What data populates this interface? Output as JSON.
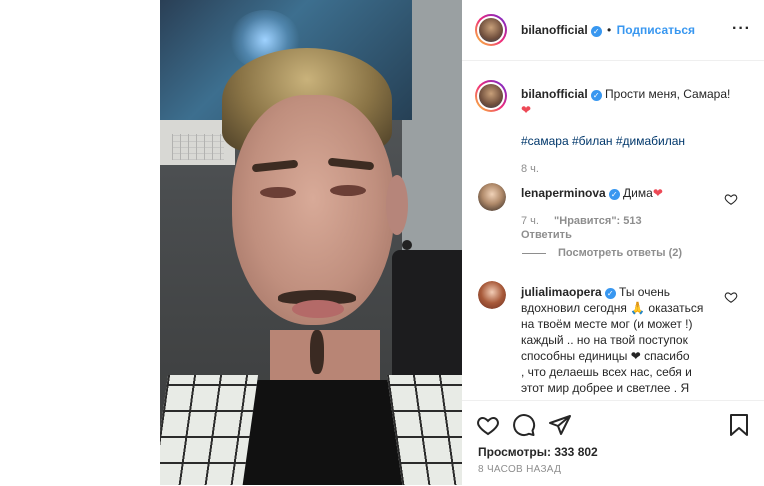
{
  "post": {
    "author": "bilanofficial",
    "header_separator": "•",
    "follow_label": "Подписаться",
    "more_icon": "more-horizontal-icon",
    "caption_text": "Прости меня, Самара!",
    "caption_emoji": "❤",
    "hashtags": [
      "#самара",
      "#билан",
      "#димабилан"
    ],
    "caption_time": "8 ч."
  },
  "comments": [
    {
      "username": "lenaperminova",
      "verified": true,
      "text": "Дима",
      "emoji": "❤",
      "time": "7 ч.",
      "likes": "\"Нравится\": 513",
      "reply_label": "Ответить",
      "view_replies": "Посмотреть ответы (2)"
    },
    {
      "username": "julialimaopera",
      "verified": true,
      "lines": [
        "Ты очень",
        "вдохновил сегодня 🙏 оказаться",
        "на твоём месте мог (и может !)",
        "каждый .. но на твой поступок",
        "способны единицы ❤ спасибо",
        ", что делаешь всех нас, себя и",
        "этот мир добрее и светлее . Я"
      ]
    }
  ],
  "actions": {
    "like_icon": "heart-outline-icon",
    "comment_icon": "comment-icon",
    "share_icon": "share-icon",
    "save_icon": "bookmark-icon"
  },
  "stats": {
    "views": "Просмотры: 333 802",
    "posted": "8 ЧАСОВ НАЗАД"
  },
  "colors": {
    "accent": "#3897f0",
    "heart": "#ed4956",
    "muted": "#8e8e8e"
  }
}
